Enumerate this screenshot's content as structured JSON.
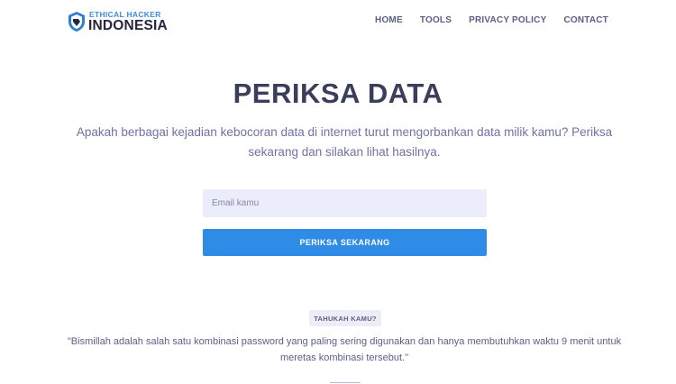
{
  "header": {
    "logo": {
      "line1": "ETHICAL HACKER",
      "line2": "INDONESIA",
      "icon": "shield-logo-icon"
    },
    "nav": [
      {
        "label": "HOME"
      },
      {
        "label": "TOOLS"
      },
      {
        "label": "PRIVACY POLICY"
      },
      {
        "label": "CONTACT"
      }
    ]
  },
  "hero": {
    "title": "PERIKSA DATA",
    "description": "Apakah berbagai kejadian kebocoran data di internet turut mengorbankan data milik kamu? Periksa sekarang dan silakan lihat hasilnya."
  },
  "form": {
    "email_value": "",
    "email_placeholder": "Email kamu",
    "submit_label": "PERIKSA SEKARANG"
  },
  "tip": {
    "badge": "TAHUKAH KAMU?",
    "text": "\"Bismillah adalah salah satu kombinasi password yang paling sering digunakan dan hanya membutuhkan waktu 9 menit untuk meretas kombinasi tersebut.\""
  },
  "colors": {
    "primary": "#2e8be6",
    "heading": "#3b3e5b",
    "muted": "#6f72a3",
    "input_bg": "#ecedfc"
  }
}
